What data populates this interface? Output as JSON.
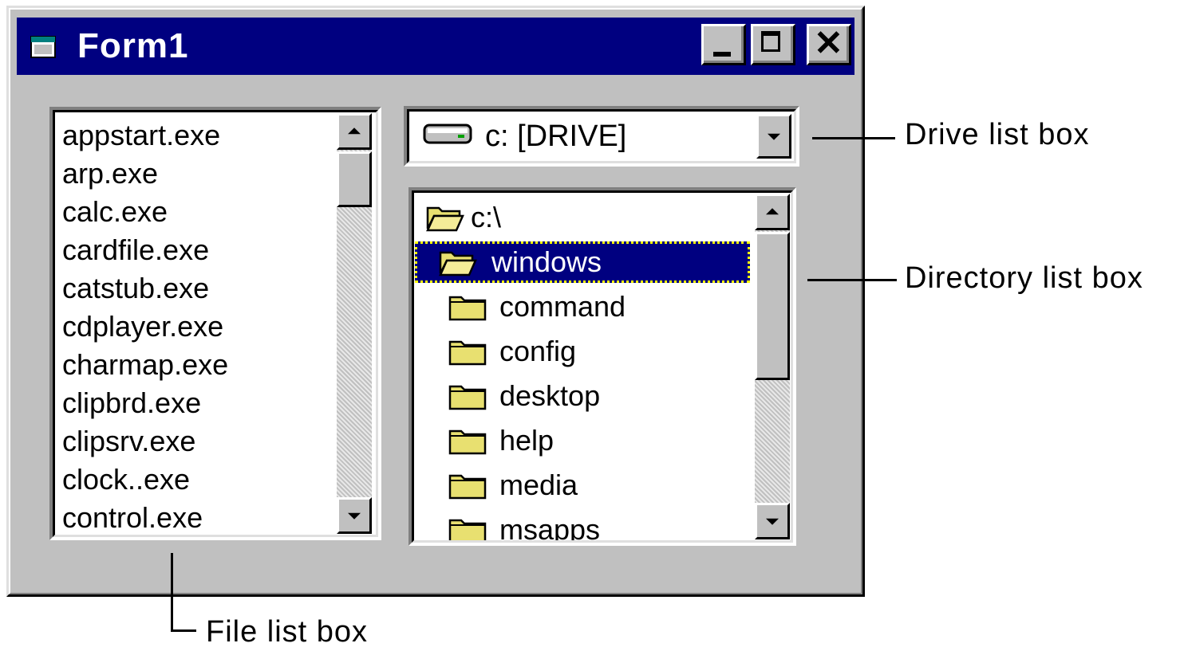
{
  "window": {
    "title": "Form1",
    "colors": {
      "face": "#c0c0c0",
      "titlebar": "#000080",
      "selection": "#000080",
      "folder": "#e8e070"
    }
  },
  "title_buttons": {
    "minimize_icon": "minimize-icon",
    "maximize_icon": "maximize-icon",
    "close_glyph": "✕"
  },
  "file_list": {
    "items": [
      "appstart.exe",
      "arp.exe",
      "calc.exe",
      "cardfile.exe",
      "catstub.exe",
      "cdplayer.exe",
      "charmap.exe",
      "clipbrd.exe",
      "clipsrv.exe",
      "clock..exe",
      "control.exe"
    ]
  },
  "drive_list": {
    "selected": "c: [DRIVE]",
    "icon": "drive-icon"
  },
  "directory_list": {
    "items": [
      {
        "label": "c:\\",
        "level": 0,
        "open": true,
        "selected": false
      },
      {
        "label": "windows",
        "level": 1,
        "open": true,
        "selected": true
      },
      {
        "label": "command",
        "level": 2,
        "open": false,
        "selected": false
      },
      {
        "label": "config",
        "level": 2,
        "open": false,
        "selected": false
      },
      {
        "label": "desktop",
        "level": 2,
        "open": false,
        "selected": false
      },
      {
        "label": "help",
        "level": 2,
        "open": false,
        "selected": false
      },
      {
        "label": "media",
        "level": 2,
        "open": false,
        "selected": false
      },
      {
        "label": "msapps",
        "level": 2,
        "open": false,
        "selected": false
      }
    ]
  },
  "annotations": {
    "drive": "Drive list box",
    "directory": "Directory list box",
    "file": "File list box"
  }
}
